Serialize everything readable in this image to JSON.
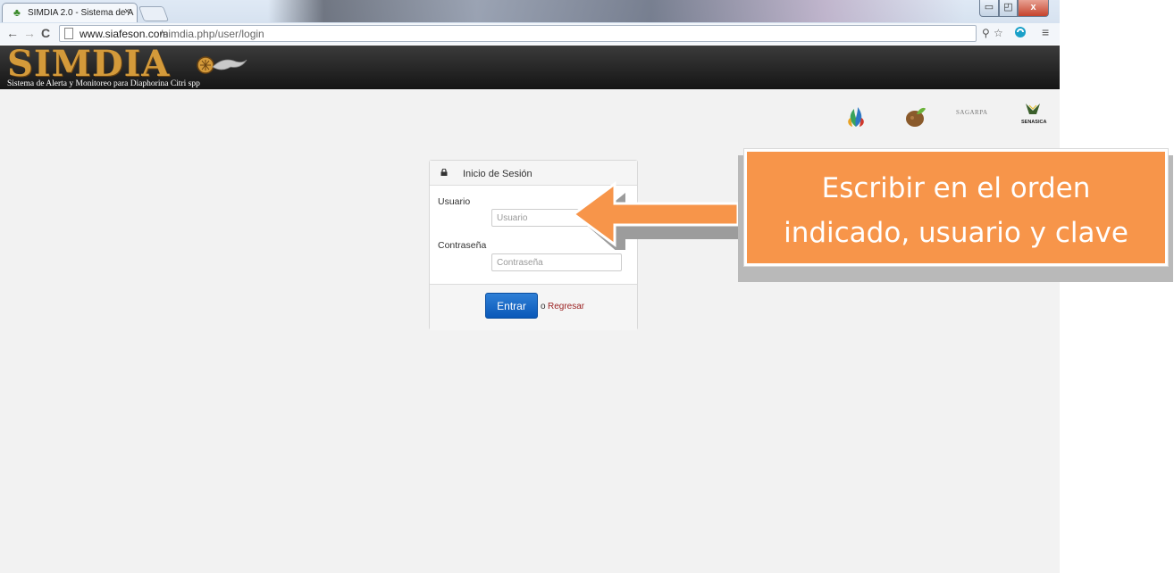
{
  "browser": {
    "tab_title": "SIMDIA 2.0 - Sistema de A",
    "tab_close": "×",
    "url_host": "www.siafeson.com",
    "url_path": "/simdia.php/user/login",
    "nav": {
      "back": "←",
      "forward": "→",
      "reload": "C"
    },
    "tools": {
      "zoom": "⚲",
      "star": "☆",
      "menu": "≡"
    },
    "window_buttons": {
      "minimize": "▭",
      "maximize": "◰",
      "close": "x"
    }
  },
  "site": {
    "logo_text": "SIMDIA",
    "tagline": "Sistema de Alerta y Monitoreo para Diaphorina Citri spp",
    "agencies": [
      "sagarpa-leaf-logo",
      "citrus-leaf-logo",
      "SAGARPA",
      "SENASICA"
    ]
  },
  "login": {
    "title": "Inicio de Sesión",
    "username_label": "Usuario",
    "username_placeholder": "Usuario",
    "password_label": "Contraseña",
    "password_placeholder": "Contraseña",
    "submit_label": "Entrar",
    "or_text": "o",
    "back_link": "Regresar"
  },
  "annotation": {
    "callout_line1": "Escribir en el orden",
    "callout_line2": "indicado, usuario y clave",
    "color": "#f7954a"
  }
}
